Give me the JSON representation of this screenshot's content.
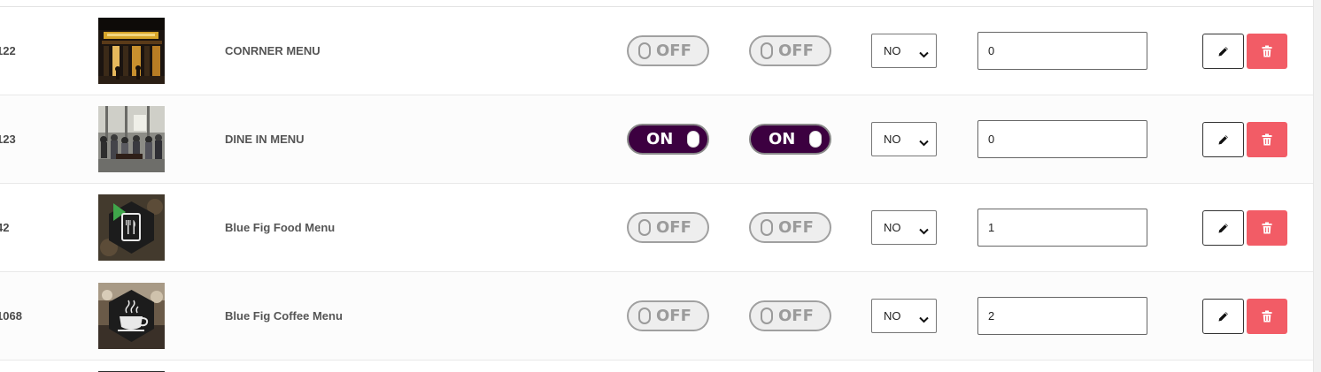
{
  "rows": [
    {
      "id": "122",
      "thumb": "corner-storefront-photo",
      "name": "CONRNER MENU",
      "toggle1": {
        "state": "OFF"
      },
      "toggle2": {
        "state": "OFF"
      },
      "select_value": "NO",
      "order": "0"
    },
    {
      "id": "123",
      "thumb": "dine-in-crowd-photo",
      "name": "DINE IN MENU",
      "toggle1": {
        "state": "ON"
      },
      "toggle2": {
        "state": "ON"
      },
      "select_value": "NO",
      "order": "0"
    },
    {
      "id": "42",
      "thumb": "food-menu-logo",
      "name": "Blue Fig Food Menu",
      "toggle1": {
        "state": "OFF"
      },
      "toggle2": {
        "state": "OFF"
      },
      "select_value": "NO",
      "order": "1"
    },
    {
      "id": "1068",
      "thumb": "coffee-menu-logo",
      "name": "Blue Fig Coffee Menu",
      "toggle1": {
        "state": "OFF"
      },
      "toggle2": {
        "state": "OFF"
      },
      "select_value": "NO",
      "order": "2"
    }
  ],
  "icons": {
    "edit": "pencil-icon",
    "delete": "trash-icon",
    "select_arrow": "chevron-down-icon"
  },
  "colors": {
    "toggle_on": "#3c0040",
    "toggle_off": "#eeeeee",
    "delete_button": "#f25c66"
  }
}
